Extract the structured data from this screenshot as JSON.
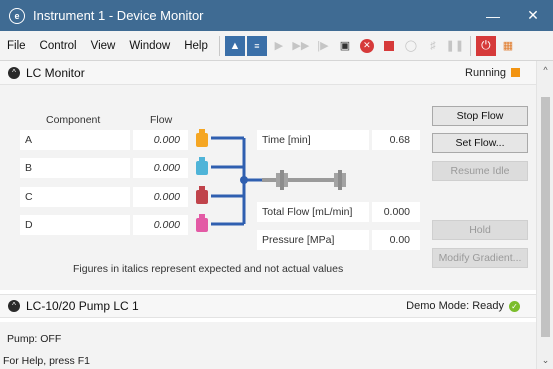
{
  "window": {
    "title": "Instrument 1 - Device Monitor"
  },
  "menu": [
    "File",
    "Control",
    "View",
    "Window",
    "Help"
  ],
  "lc_monitor": {
    "title": "LC Monitor",
    "status": "Running",
    "col_component": "Component",
    "col_flow": "Flow",
    "rows": [
      {
        "name": "A",
        "flow": "0.000",
        "color": "#f5a623"
      },
      {
        "name": "B",
        "flow": "0.000",
        "color": "#4fb4d8"
      },
      {
        "name": "C",
        "flow": "0.000",
        "color": "#c0434b"
      },
      {
        "name": "D",
        "flow": "0.000",
        "color": "#e35aa5"
      }
    ],
    "time_label": "Time [min]",
    "time_value": "0.68",
    "total_flow_label": "Total Flow [mL/min]",
    "total_flow_value": "0.000",
    "pressure_label": "Pressure [MPa]",
    "pressure_value": "0.00",
    "note": "Figures in italics represent expected and not actual values",
    "buttons": {
      "stop_flow": "Stop Flow",
      "set_flow": "Set Flow...",
      "resume_idle": "Resume Idle",
      "hold": "Hold",
      "modify_gradient": "Modify Gradient..."
    }
  },
  "pump": {
    "title": "LC-10/20 Pump LC 1",
    "status": "Demo Mode: Ready",
    "state": "Pump: OFF"
  },
  "statusbar": {
    "text": "For Help, press F1"
  }
}
